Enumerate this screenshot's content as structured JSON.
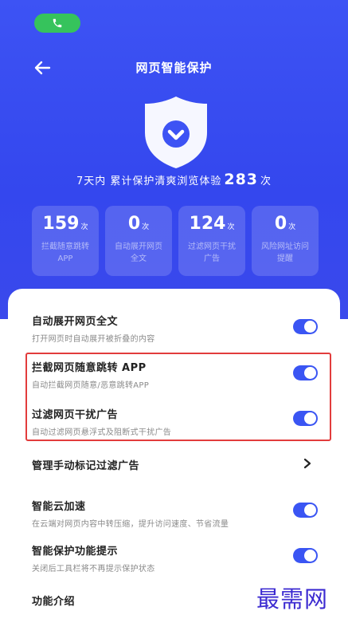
{
  "header": {
    "title": "网页智能保护"
  },
  "summary": {
    "prefix": "7天内 累计保护清爽浏览体验",
    "count": "283",
    "suffix": "次"
  },
  "stats": [
    {
      "value": "159",
      "unit": "次",
      "label": "拦截随意跳转APP"
    },
    {
      "value": "0",
      "unit": "次",
      "label": "自动展开网页全文"
    },
    {
      "value": "124",
      "unit": "次",
      "label": "过滤网页干扰广告"
    },
    {
      "value": "0",
      "unit": "次",
      "label": "风险网址访问提醒"
    }
  ],
  "settings": [
    {
      "title": "自动展开网页全文",
      "subtitle": "打开网页时自动展开被折叠的内容",
      "enabled": true
    },
    {
      "title": "拦截网页随意跳转 APP",
      "subtitle": "自动拦截网页随意/恶意跳转APP",
      "enabled": true
    },
    {
      "title": "过滤网页干扰广告",
      "subtitle": "自动过滤网页悬浮式及阻断式干扰广告",
      "enabled": true
    },
    {
      "title": "管理手动标记过滤广告"
    },
    {
      "title": "智能云加速",
      "subtitle": "在云端对网页内容中转压缩，提升访问速度、节省流量",
      "enabled": true
    },
    {
      "title": "智能保护功能提示",
      "subtitle": "关闭后工具栏将不再提示保护状态",
      "enabled": true
    },
    {
      "title": "功能介绍"
    }
  ],
  "watermark": "最需网",
  "colors": {
    "header_bg": "#3d53f4",
    "toggle_on": "#3a55f3",
    "highlight": "#e23c3c",
    "call_pill": "#36c35c"
  }
}
